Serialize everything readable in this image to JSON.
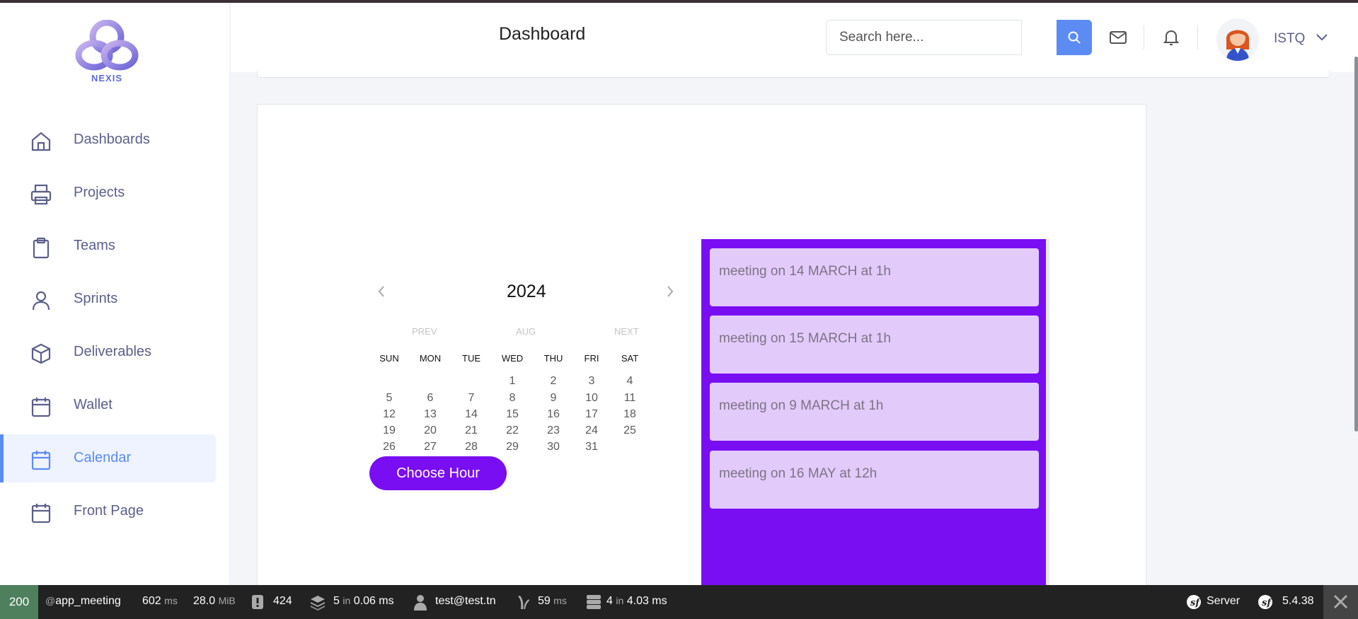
{
  "brand": {
    "logo_text": "NEXIS"
  },
  "sidebar": {
    "items": [
      {
        "label": "Dashboards",
        "icon": "home-icon"
      },
      {
        "label": "Projects",
        "icon": "printer-icon"
      },
      {
        "label": "Teams",
        "icon": "clipboard-icon"
      },
      {
        "label": "Sprints",
        "icon": "user-icon"
      },
      {
        "label": "Deliverables",
        "icon": "box-icon"
      },
      {
        "label": "Wallet",
        "icon": "calendar-icon"
      },
      {
        "label": "Calendar",
        "icon": "calendar-icon",
        "active": true
      },
      {
        "label": "Front Page",
        "icon": "calendar-icon"
      }
    ]
  },
  "header": {
    "title": "Dashboard",
    "search_placeholder": "Search here...",
    "user_name": "ISTQ"
  },
  "calendar": {
    "year": "2024",
    "prev_label": "PREV",
    "month_label": "AUG",
    "next_label": "NEXT",
    "weekdays": [
      "SUN",
      "MON",
      "TUE",
      "WED",
      "THU",
      "FRI",
      "SAT"
    ],
    "weeks": [
      [
        "",
        "",
        "",
        "1",
        "2",
        "3",
        "4"
      ],
      [
        "5",
        "6",
        "7",
        "8",
        "9",
        "10",
        "11"
      ],
      [
        "12",
        "13",
        "14",
        "15",
        "16",
        "17",
        "18"
      ],
      [
        "19",
        "20",
        "21",
        "22",
        "23",
        "24",
        "25"
      ],
      [
        "26",
        "27",
        "28",
        "29",
        "30",
        "31",
        ""
      ]
    ],
    "choose_hour_label": "Choose Hour"
  },
  "events": [
    "meeting on 14 MARCH at 1h",
    "meeting on 15 MARCH at 1h",
    "meeting on 9 MARCH at 1h",
    "meeting on 16 MAY at 12h"
  ],
  "toolbar": {
    "status": "200",
    "route_prefix": "@",
    "route": "app_meeting",
    "time_value": "602",
    "time_unit": "ms",
    "memory_value": "28.0",
    "memory_unit": "MiB",
    "logs": "424",
    "cache_count": "5",
    "cache_in": "in",
    "cache_time": "0.06 ms",
    "user": "test@test.tn",
    "twig_time": "59",
    "twig_unit": "ms",
    "db_count": "4",
    "db_in": "in",
    "db_time": "4.03 ms",
    "server_label": "Server",
    "version": "5.4.38"
  },
  "colors": {
    "accent": "#5d8bf4",
    "event_panel": "#7a0ef2",
    "event_card": "#e2cbfb"
  }
}
